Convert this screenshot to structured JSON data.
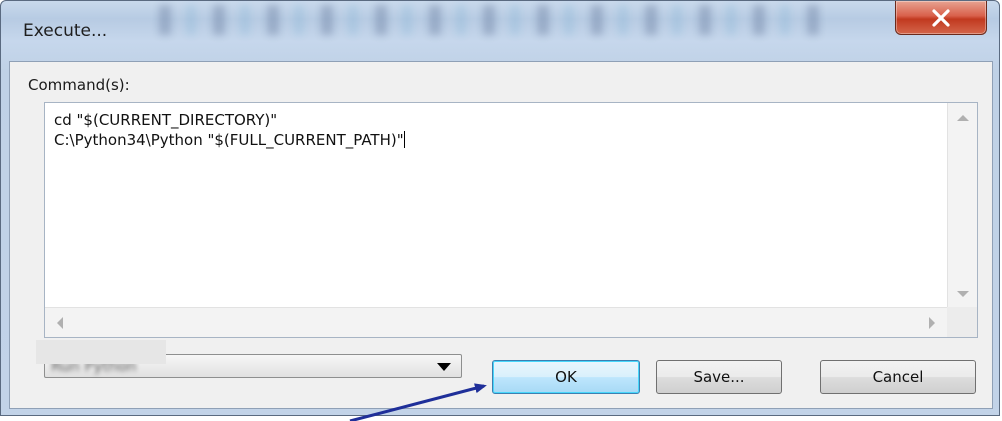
{
  "window": {
    "title": "Execute...",
    "close_icon": "close-x-icon"
  },
  "command": {
    "label": "Command(s):",
    "lines": [
      "cd \"$(CURRENT_DIRECTORY)\"",
      "C:\\Python34\\Python \"$(FULL_CURRENT_PATH)\""
    ]
  },
  "combo": {
    "selected": "Run Python"
  },
  "buttons": {
    "ok": "OK",
    "save": "Save...",
    "cancel": "Cancel"
  },
  "colors": {
    "close_button": "#c1391f",
    "ok_border": "#3c7fb1",
    "annotation_arrow": "#1f2f99"
  }
}
